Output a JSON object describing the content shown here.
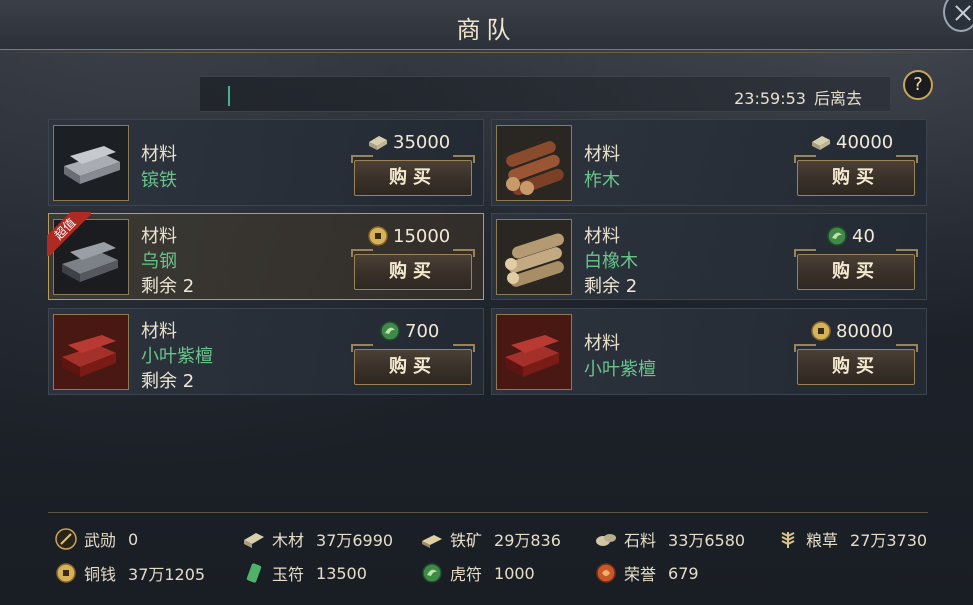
{
  "header": {
    "title": "商队"
  },
  "timer": {
    "time": "23:59:53",
    "suffix": "后离去",
    "help": "?"
  },
  "items": [
    {
      "category": "材料",
      "name": "镔铁",
      "remaining": "",
      "price": "35000",
      "currency": "silver-ingot-icon",
      "buy_label": "购买",
      "badge": "",
      "thumb": "iron-bars-icon"
    },
    {
      "category": "材料",
      "name": "柞木",
      "remaining": "",
      "price": "40000",
      "currency": "silver-ingot-icon",
      "buy_label": "购买",
      "badge": "",
      "thumb": "logs-icon"
    },
    {
      "category": "材料",
      "name": "乌钢",
      "remaining": "剩余 2",
      "price": "15000",
      "currency": "copper-coin-icon",
      "buy_label": "购买",
      "badge": "超值",
      "thumb": "steel-bars-icon"
    },
    {
      "category": "材料",
      "name": "白橡木",
      "remaining": "剩余 2",
      "price": "40",
      "currency": "tiger-token-icon",
      "buy_label": "购买",
      "badge": "",
      "thumb": "oak-logs-icon"
    },
    {
      "category": "材料",
      "name": "小叶紫檀",
      "remaining": "剩余 2",
      "price": "700",
      "currency": "tiger-token-icon",
      "buy_label": "购买",
      "badge": "",
      "thumb": "red-wood-icon"
    },
    {
      "category": "材料",
      "name": "小叶紫檀",
      "remaining": "",
      "price": "80000",
      "currency": "copper-coin-icon",
      "buy_label": "购买",
      "badge": "",
      "thumb": "red-wood-icon"
    }
  ],
  "resources": [
    {
      "label": "武勋",
      "value": "0",
      "icon": "sword-medal-icon"
    },
    {
      "label": "木材",
      "value": "37万6990",
      "icon": "wood-icon"
    },
    {
      "label": "铁矿",
      "value": "29万836",
      "icon": "iron-ore-icon"
    },
    {
      "label": "石料",
      "value": "33万6580",
      "icon": "stone-icon"
    },
    {
      "label": "粮草",
      "value": "27万3730",
      "icon": "grain-icon"
    },
    {
      "label": "铜钱",
      "value": "37万1205",
      "icon": "copper-coin-icon"
    },
    {
      "label": "玉符",
      "value": "13500",
      "icon": "jade-token-icon"
    },
    {
      "label": "虎符",
      "value": "1000",
      "icon": "tiger-token-icon"
    },
    {
      "label": "荣誉",
      "value": "679",
      "icon": "honor-icon"
    }
  ],
  "colors": {
    "accent_gold": "#b99b5c",
    "name_green": "#69c48c",
    "badge_red": "#b02a24"
  }
}
